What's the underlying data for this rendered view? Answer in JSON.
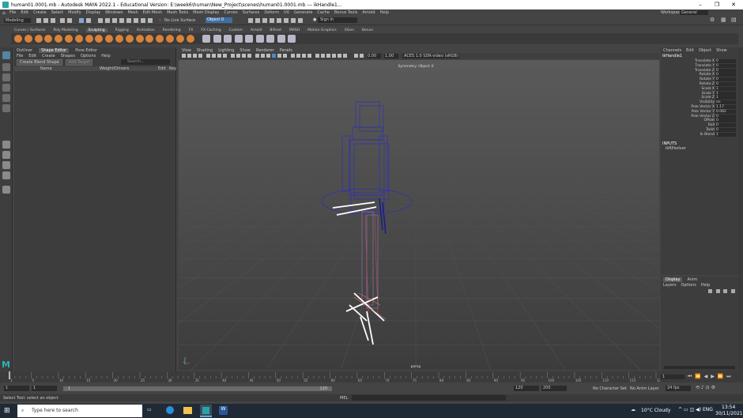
{
  "title": "human01.0001.mb - Autodesk MAYA 2022.1 - Educational Version: E:\\week6\\human\\New_Project\\scenes\\human01.0001.mb --- ikHandle1...",
  "menubar": [
    "File",
    "Edit",
    "Create",
    "Select",
    "Modify",
    "Display",
    "Windows",
    "Mesh",
    "Edit Mesh",
    "Mesh Tools",
    "Mesh Display",
    "Curves",
    "Surfaces",
    "Deform",
    "UV",
    "Generate",
    "Cache",
    "Bonus Tools",
    "Arnold",
    "Help"
  ],
  "workspace": {
    "label": "Workspace :",
    "value": "General"
  },
  "status": {
    "mode": "Modeling",
    "no_live_surface": "No Live Surface",
    "object_field": "Object 0",
    "sign_in": "Sign In"
  },
  "shelf_tabs": [
    "Curves / Surfaces",
    "Poly Modeling",
    "Sculpting",
    "Rigging",
    "Animation",
    "Rendering",
    "FX",
    "FX Caching",
    "Custom",
    "Arnold",
    "Bifrost",
    "MASH",
    "Motion Graphics",
    "XGen",
    "Bonus"
  ],
  "shelf_active": "Sculpting",
  "outliner": {
    "tabs": [
      "Outliner",
      "Shape Editor",
      "Pose Editor"
    ],
    "active_tab": "Shape Editor",
    "menus": [
      "File",
      "Edit",
      "Create",
      "Shapes",
      "Options",
      "Help"
    ],
    "create_blend_shape": "Create Blend Shape",
    "add_target": "Add Target",
    "search_placeholder": "Search...",
    "col_name": "Name",
    "col_weight": "Weight/Drivers",
    "col_edit": "Edit",
    "col_key": "Key"
  },
  "viewport": {
    "menus": [
      "View",
      "Shading",
      "Lighting",
      "Show",
      "Renderer",
      "Panels"
    ],
    "symmetry": "Symmetry: Object X",
    "camera": "persp",
    "field1": "0.00",
    "field2": "1.00",
    "colorspace": "ACES 1.0 SDR-video (sRGB)"
  },
  "channel_box": {
    "menus": [
      "Channels",
      "Edit",
      "Object",
      "Show"
    ],
    "object": "ikHandle1",
    "attributes": [
      {
        "name": "Translate X",
        "value": "0"
      },
      {
        "name": "Translate Y",
        "value": "0"
      },
      {
        "name": "Translate Z",
        "value": "0"
      },
      {
        "name": "Rotate X",
        "value": "0"
      },
      {
        "name": "Rotate Y",
        "value": "0"
      },
      {
        "name": "Rotate Z",
        "value": "0"
      },
      {
        "name": "Scale X",
        "value": "1"
      },
      {
        "name": "Scale Y",
        "value": "1"
      },
      {
        "name": "Scale Z",
        "value": "1"
      },
      {
        "name": "Visibility",
        "value": "on"
      },
      {
        "name": "Pole Vector X",
        "value": "1.17"
      },
      {
        "name": "Pole Vector Y",
        "value": "0.082"
      },
      {
        "name": "Pole Vector Z",
        "value": "0"
      },
      {
        "name": "Offset",
        "value": "0"
      },
      {
        "name": "Roll",
        "value": "0"
      },
      {
        "name": "Twist",
        "value": "0"
      },
      {
        "name": "Ik Blend",
        "value": "1"
      }
    ],
    "inputs_label": "INPUTS",
    "inputs_item": "ikRPsolver"
  },
  "layer_editor": {
    "tabs": [
      "Display",
      "Anim"
    ],
    "menus": [
      "Layers",
      "Options",
      "Help"
    ]
  },
  "time": {
    "ticks": [
      "1",
      "5",
      "10",
      "15",
      "20",
      "25",
      "30",
      "35",
      "40",
      "45",
      "50",
      "55",
      "60",
      "65",
      "70",
      "75",
      "80",
      "85",
      "90",
      "95",
      "100",
      "105",
      "110",
      "115",
      "120"
    ],
    "current_frame": "1",
    "range_start": "1",
    "range_start2": "1",
    "range_inner_start": "1",
    "range_inner_end": "120",
    "range_end": "120",
    "range_end2": "200",
    "char_set": "No Character Set",
    "anim_layer": "No Anim Layer",
    "fps": "24 fps"
  },
  "cmdline": {
    "label": "MEL"
  },
  "helpline": "Select Tool: select an object",
  "taskbar": {
    "search": "Type here to search",
    "weather": "10°C  Cloudy",
    "time": "13:54",
    "date": "30/11/2021"
  }
}
